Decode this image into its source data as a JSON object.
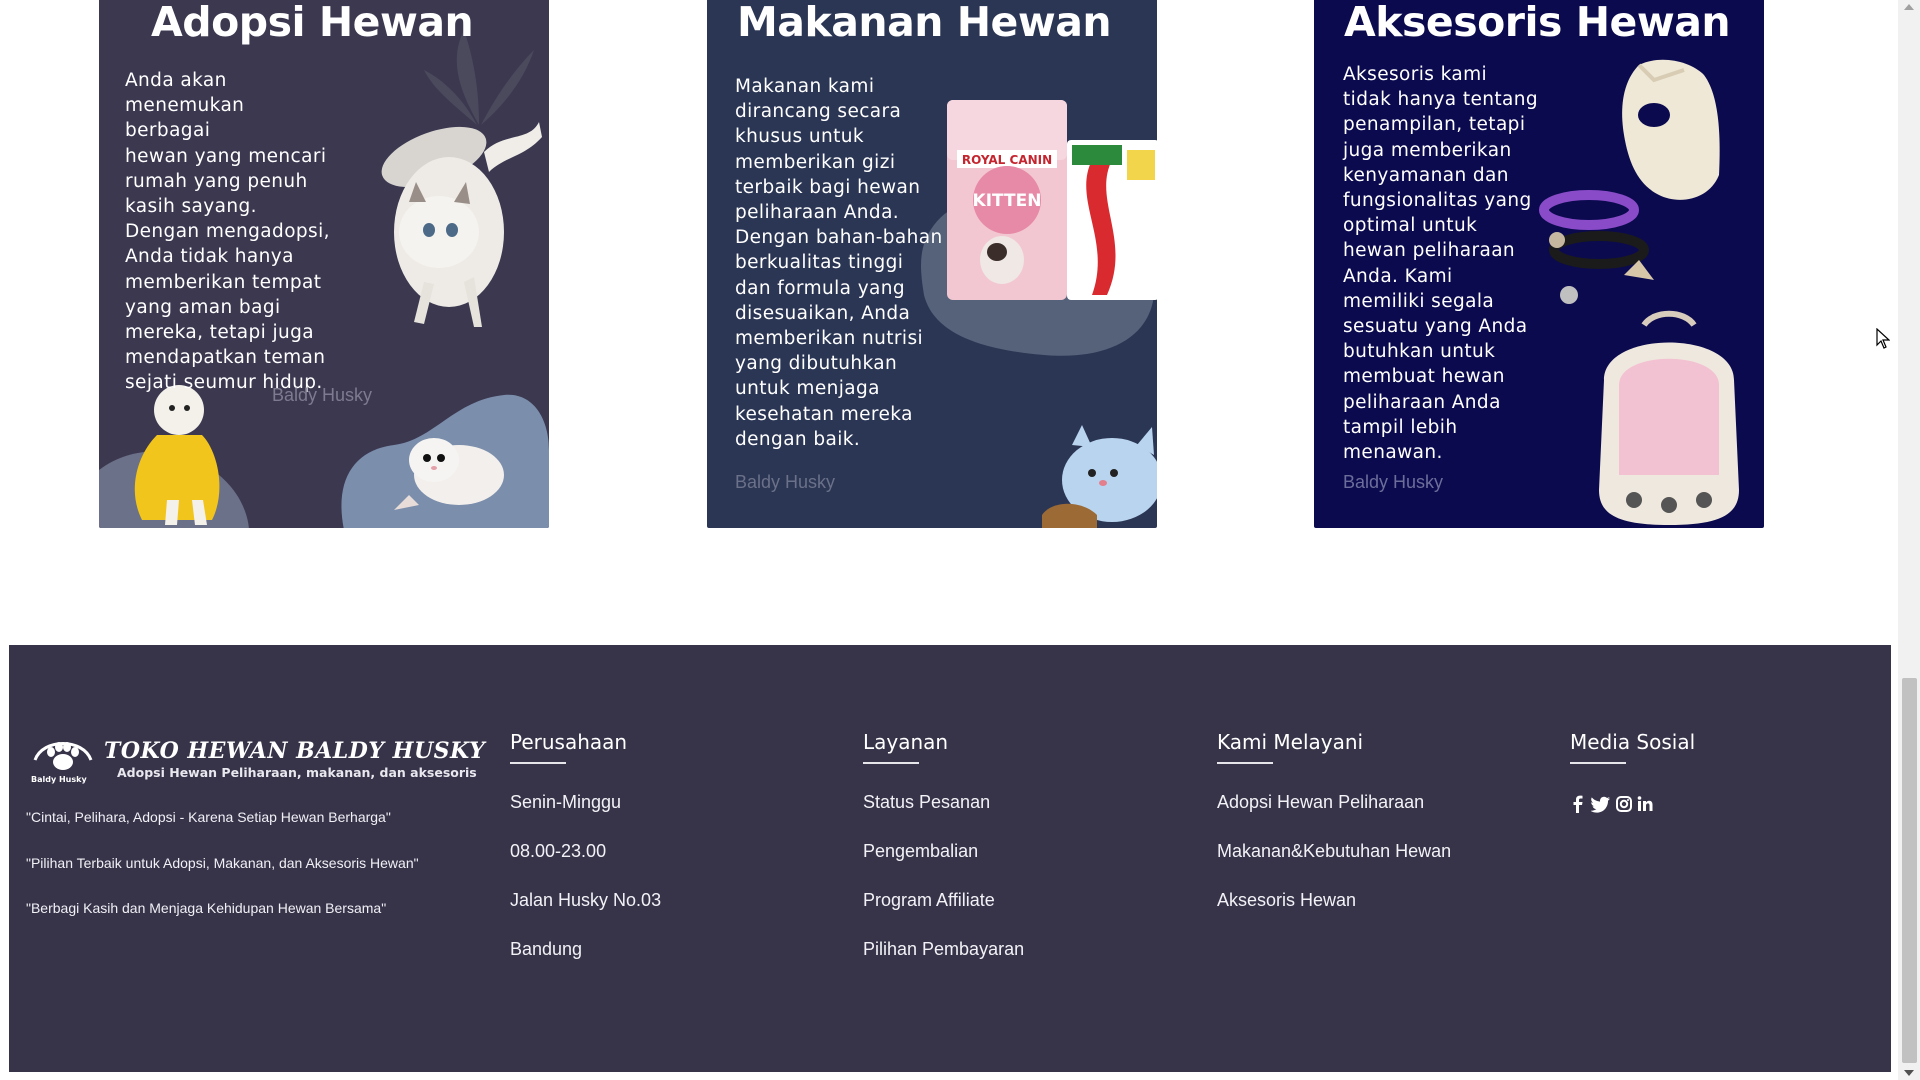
{
  "cards": [
    {
      "title": "Adopsi Hewan",
      "text": "Anda akan\nmenemukan berbagai\nhewan yang mencari\nrumah yang penuh\nkasih sayang.\nDengan mengadopsi,\nAnda tidak hanya\nmemberikan tempat\nyang aman bagi\nmereka, tetapi juga\nmendapatkan teman\nsejati seumur hidup.",
      "watermark": "Baldy Husky",
      "background": "#3b3850"
    },
    {
      "title": "Makanan Hewan",
      "text": "Makanan kami\ndirancang secara\nkhusus untuk\nmemberikan gizi\nterbaik bagi hewan\npeliharaan Anda.\nDengan bahan-bahan\nberkualitas tinggi\ndan formula yang\ndisesuaikan,  Anda\nmemberikan nutrisi\nyang dibutuhkan\nuntuk menjaga\nkesehatan mereka\ndengan baik.",
      "watermark": "Baldy Husky",
      "background": "#2b3654",
      "product_label": "ROYAL CANIN",
      "product_name": "KITTEN"
    },
    {
      "title": "Aksesoris Hewan",
      "text": "Aksesoris kami\ntidak hanya tentang\npenampilan, tetapi\njuga memberikan\nkenyamanan dan\nfungsionalitas yang\noptimal untuk\nhewan peliharaan\nAnda. Kami\nmemiliki segala\nsesuatu yang Anda\nbutuhkan untuk\nmembuat hewan\npeliharaan Anda\ntampil lebih\nmenawan.",
      "watermark": "Baldy Husky",
      "background": "#0b0a4f"
    }
  ],
  "footer": {
    "brand": {
      "name": "TOKO HEWAN BALDY HUSKY",
      "tagline": "Adopsi Hewan Peliharaan, makanan, dan aksesoris",
      "mini_label": "Baldy Husky"
    },
    "quotes": [
      "\"Cintai, Pelihara, Adopsi - Karena Setiap Hewan Berharga\"",
      "\"Pilihan Terbaik untuk Adopsi, Makanan, dan Aksesoris Hewan\"",
      "\"Berbagi Kasih dan Menjaga Kehidupan Hewan Bersama\""
    ],
    "columns": [
      {
        "heading": "Perusahaan",
        "items": [
          "Senin-Minggu",
          "08.00-23.00",
          "Jalan Husky No.03",
          "Bandung"
        ]
      },
      {
        "heading": "Layanan",
        "items": [
          "Status Pesanan",
          "Pengembalian",
          "Program Affiliate",
          "Pilihan Pembayaran"
        ]
      },
      {
        "heading": "Kami Melayani",
        "items": [
          "Adopsi Hewan Peliharaan",
          "Makanan&Kebutuhan Hewan",
          "Aksesoris Hewan"
        ]
      },
      {
        "heading": "Media Sosial",
        "icons": [
          "facebook-icon",
          "twitter-icon",
          "instagram-icon",
          "linkedin-icon"
        ]
      }
    ],
    "background": "#37344a"
  }
}
